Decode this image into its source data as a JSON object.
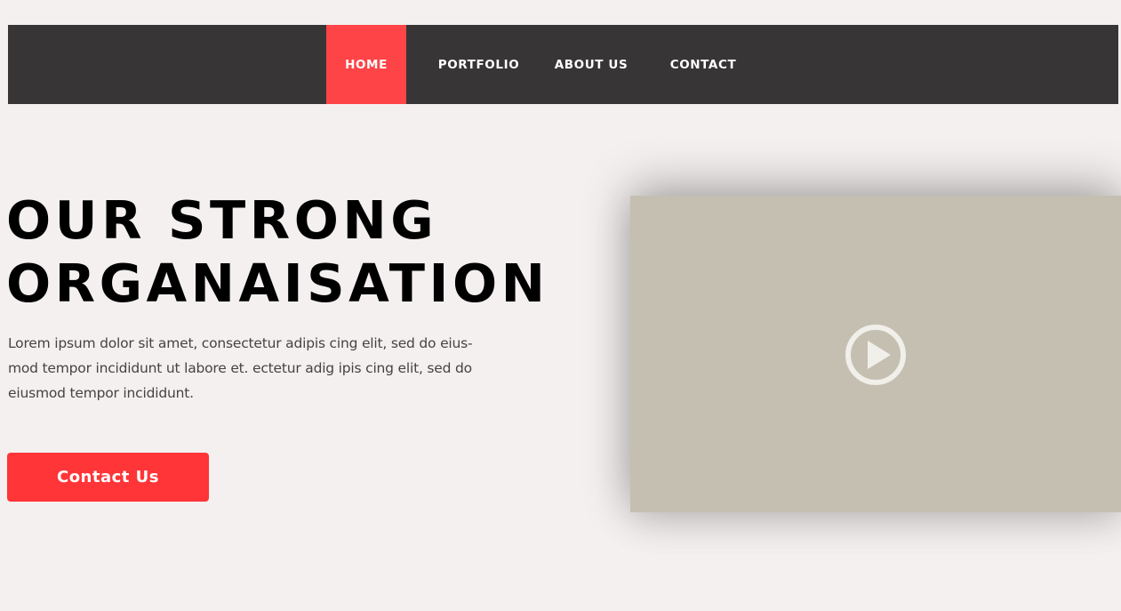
{
  "nav": {
    "items": [
      {
        "label": "HOME",
        "active": true
      },
      {
        "label": "PORTFOLIO",
        "active": false
      },
      {
        "label": "ABOUT US",
        "active": false
      },
      {
        "label": "CONTACT",
        "active": false
      }
    ]
  },
  "hero": {
    "title_line1": "OUR STRONG",
    "title_line2": "ORGANAISATION",
    "description": "Lorem ipsum dolor sit amet, consectetur adipis cing elit, sed do eius-\nmod tempor incididunt  ut labore et. ectetur adig ipis cing elit, sed do\neiusmod tempor incididunt.",
    "cta_label": "Contact Us"
  },
  "video": {
    "play_icon": "play-circle-icon"
  },
  "colors": {
    "background": "#f4f0ef",
    "navbar": "#373536",
    "accent": "#ff4447",
    "button": "#ff3538",
    "video_placeholder": "#c5bfb2"
  }
}
